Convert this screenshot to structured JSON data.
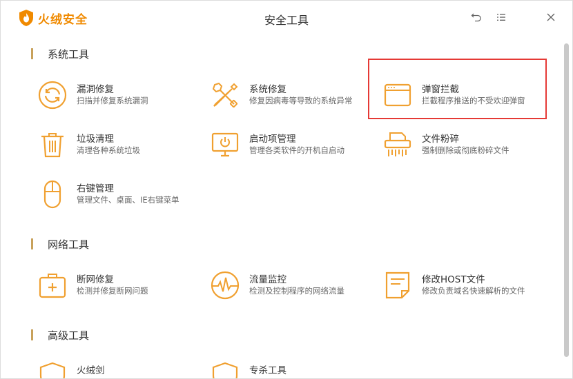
{
  "app": {
    "name": "火绒安全",
    "window_title": "安全工具"
  },
  "colors": {
    "accent": "#f0a030",
    "brand": "#f08a00",
    "highlight": "#e53935"
  },
  "sections": [
    {
      "title": "系统工具",
      "tools": [
        {
          "name": "漏洞修复",
          "desc": "扫描并修复系统漏洞",
          "icon": "refresh-circle-icon"
        },
        {
          "name": "系统修复",
          "desc": "修复因病毒等导致的系统异常",
          "icon": "wrench-screwdriver-icon"
        },
        {
          "name": "弹窗拦截",
          "desc": "拦截程序推送的不受欢迎弹窗",
          "icon": "popup-window-icon"
        },
        {
          "name": "垃圾清理",
          "desc": "清理各种系统垃圾",
          "icon": "trash-icon"
        },
        {
          "name": "启动项管理",
          "desc": "管理各类软件的开机自启动",
          "icon": "monitor-power-icon"
        },
        {
          "name": "文件粉碎",
          "desc": "强制删除或彻底粉碎文件",
          "icon": "shredder-icon"
        },
        {
          "name": "右键管理",
          "desc": "管理文件、桌面、IE右键菜单",
          "icon": "mouse-icon"
        }
      ]
    },
    {
      "title": "网络工具",
      "tools": [
        {
          "name": "断网修复",
          "desc": "检测并修复断网问题",
          "icon": "first-aid-kit-icon"
        },
        {
          "name": "流量监控",
          "desc": "检测及控制程序的网络流量",
          "icon": "pulse-gauge-icon"
        },
        {
          "name": "修改HOST文件",
          "desc": "修改负责域名快速解析的文件",
          "icon": "document-icon"
        }
      ]
    },
    {
      "title": "高级工具",
      "tools": [
        {
          "name": "火绒剑",
          "icon": "shield-icon"
        },
        {
          "name": "专杀工具",
          "icon": "shield-icon"
        }
      ]
    }
  ]
}
